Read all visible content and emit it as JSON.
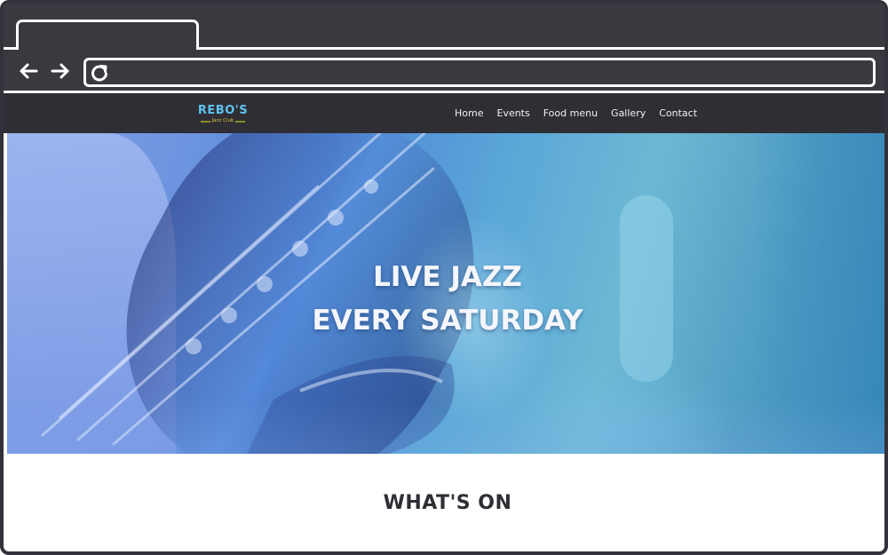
{
  "site": {
    "logo": {
      "title": "REBO'S",
      "subtitle": "Jazz Club"
    },
    "nav": [
      "Home",
      "Events",
      "Food menu",
      "Gallery",
      "Contact"
    ]
  },
  "hero": {
    "lines": [
      "LIVE JAZZ",
      "EVERY SATURDAY"
    ]
  },
  "content": {
    "section_heading": "WHAT'S ON"
  },
  "browser": {
    "icons": [
      "back-arrow-icon",
      "forward-arrow-icon",
      "reload-icon"
    ]
  },
  "colors": {
    "logo_title": "#5ec3ee",
    "logo_subtitle": "#d8c84a",
    "header_bg": "#2f2e34",
    "chrome_bg": "#3a3940"
  }
}
